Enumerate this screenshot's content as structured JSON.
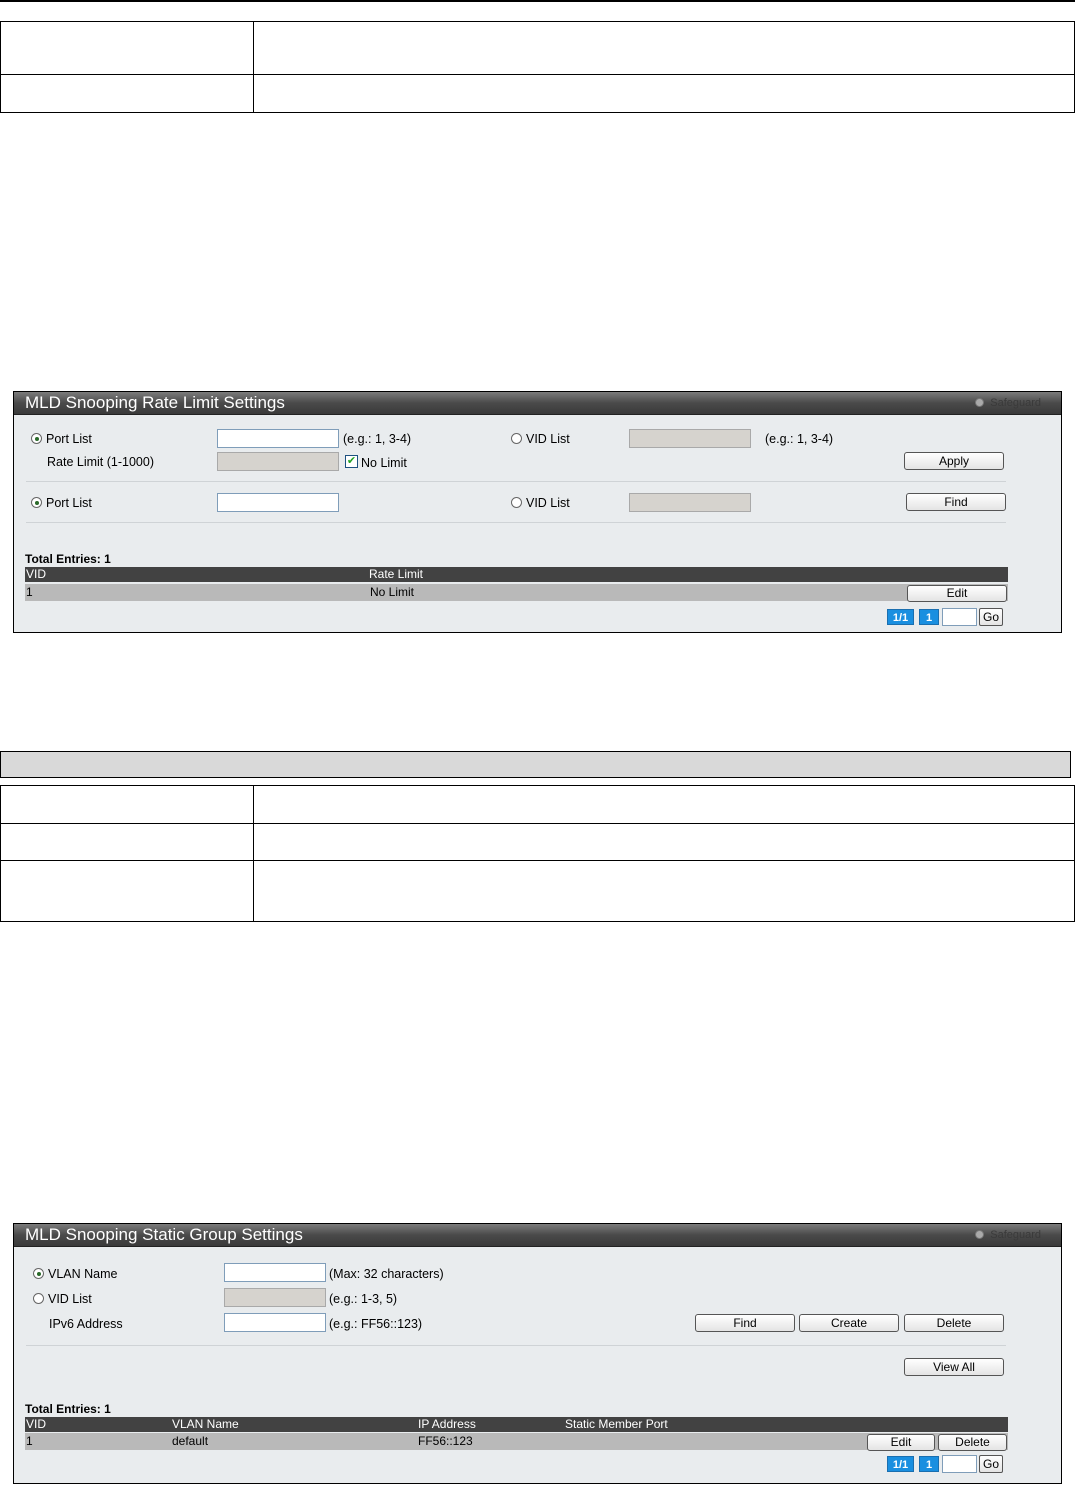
{
  "rate_limit_panel": {
    "title": "MLD Snooping Rate Limit Settings",
    "safeguard_label": "Safeguard",
    "form1": {
      "port_list_label": "Port List",
      "port_list_hint": "(e.g.: 1, 3-4)",
      "vid_list_label": "VID List",
      "vid_list_hint": "(e.g.: 1, 3-4)",
      "rate_limit_label": "Rate Limit (1-1000)",
      "no_limit_label": "No Limit",
      "no_limit_checked": true,
      "apply_label": "Apply"
    },
    "form2": {
      "port_list_label": "Port List",
      "vid_list_label": "VID List",
      "find_label": "Find"
    },
    "total_entries": "Total Entries: 1",
    "columns": [
      "VID",
      "Rate Limit"
    ],
    "rows": [
      {
        "vid": "1",
        "rate_limit": "No Limit",
        "edit_label": "Edit"
      }
    ],
    "pagination": {
      "page_info": "1/1",
      "page_num": "1",
      "go_label": "Go"
    }
  },
  "static_group_panel": {
    "title": "MLD Snooping Static Group Settings",
    "safeguard_label": "Safeguard",
    "vlan_name_label": "VLAN Name",
    "vlan_name_hint": "(Max: 32 characters)",
    "vid_list_label": "VID List",
    "vid_list_hint": "(e.g.: 1-3, 5)",
    "ipv6_label": "IPv6 Address",
    "ipv6_hint": "(e.g.: FF56::123)",
    "find_label": "Find",
    "create_label": "Create",
    "delete_label": "Delete",
    "view_all_label": "View All",
    "total_entries": "Total Entries: 1",
    "columns": [
      "VID",
      "VLAN Name",
      "IP Address",
      "Static Member Port"
    ],
    "rows": [
      {
        "vid": "1",
        "vlan_name": "default",
        "ip_address": "FF56::123",
        "static_member_port": "",
        "edit_label": "Edit",
        "delete_label": "Delete"
      }
    ],
    "pagination": {
      "page_info": "1/1",
      "page_num": "1",
      "go_label": "Go"
    }
  },
  "colors": {
    "title_bar": "#3a3a3a",
    "panel_bg": "#e9ecee",
    "table_header": "#424242",
    "table_row": "#b9b9b9",
    "page_button": "#1a8fe0"
  }
}
